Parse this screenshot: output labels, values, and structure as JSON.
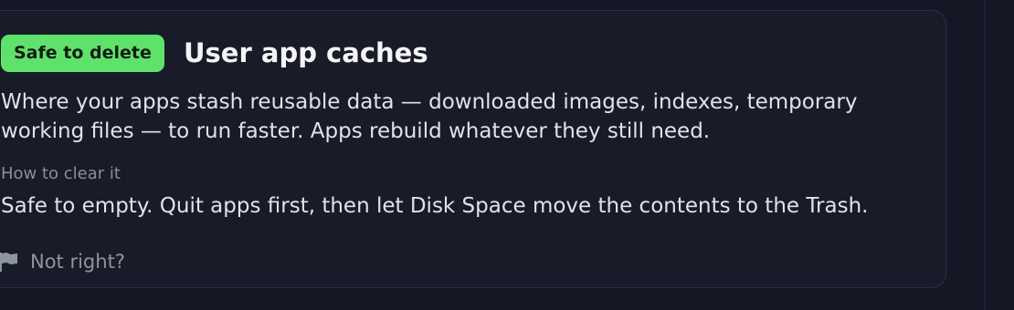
{
  "card": {
    "badge": "Safe to delete",
    "title": "User app caches",
    "description": "Where your apps stash reusable data — downloaded images, indexes, temporary working files — to run faster. Apps rebuild whatever they still need.",
    "how_label": "How to clear it",
    "how_text": "Safe to empty. Quit apps first, then let Disk Space move the contents to the Trash.",
    "report_label": "Not right?",
    "report_icon": "flag-icon"
  },
  "colors": {
    "background": "#141824",
    "card": "#181b28",
    "badge": "#5ee36a",
    "text": "#e0e3ea",
    "muted": "#8a8f9c"
  }
}
